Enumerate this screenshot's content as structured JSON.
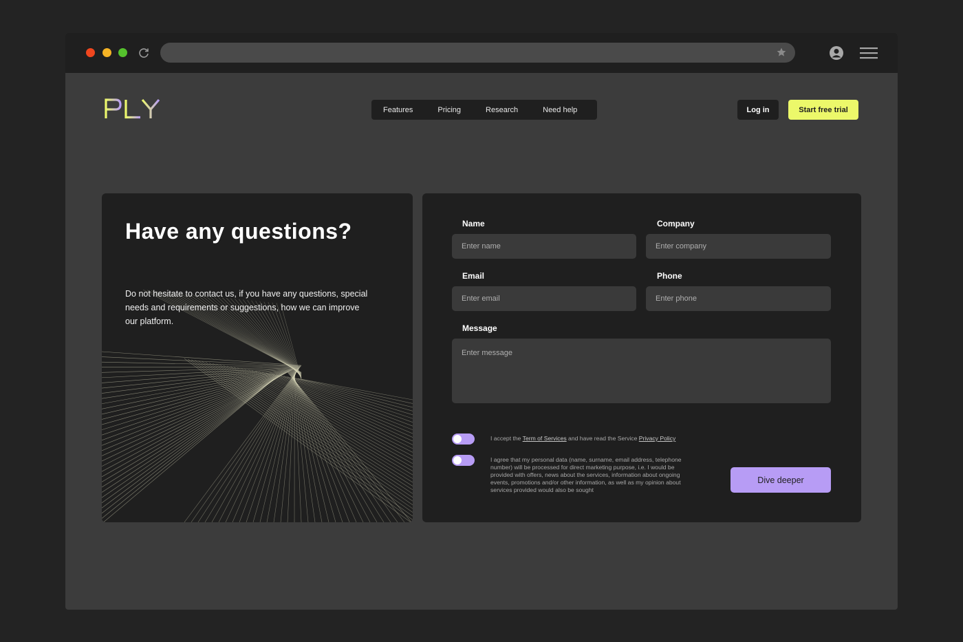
{
  "browser": {
    "controls": [
      "close",
      "minimize",
      "maximize"
    ],
    "icons": [
      "reload-icon",
      "star-icon",
      "profile-icon",
      "hamburger-menu-icon"
    ]
  },
  "header": {
    "logo_text": "PLY",
    "nav": [
      "Features",
      "Pricing",
      "Research",
      "Need help"
    ],
    "login_label": "Log in",
    "trial_label": "Start free trial"
  },
  "intro": {
    "title": "Have any questions?",
    "description": "Do not hesitate to contact us, if you have any questions, special needs and requirements or suggestions, how we can improve our platform."
  },
  "form": {
    "name": {
      "label": "Name",
      "placeholder": "Enter name"
    },
    "company": {
      "label": "Company",
      "placeholder": "Enter company"
    },
    "email": {
      "label": "Email",
      "placeholder": "Enter email"
    },
    "phone": {
      "label": "Phone",
      "placeholder": "Enter phone"
    },
    "message": {
      "label": "Message",
      "placeholder": "Enter message"
    },
    "consent1": {
      "prefix": "I accept the ",
      "terms_link": "Term of Services",
      "middle": " and have read the Service ",
      "privacy_link": "Privacy Policy"
    },
    "consent2": "I agree that my personal data (name, surname, email address, telephone number) will be processed for direct marketing purpose, i.e. I would be provided with offers, news about the services, information about ongoing events, promotions and/or other information, as well as my opinion about services provided would also be sought",
    "submit_label": "Dive deeper"
  },
  "colors": {
    "accent_lime": "#ecf86a",
    "accent_purple": "#b79cf5",
    "surface": "#1f1f1f",
    "page": "#3c3c3c",
    "field": "#3a3a3a"
  }
}
